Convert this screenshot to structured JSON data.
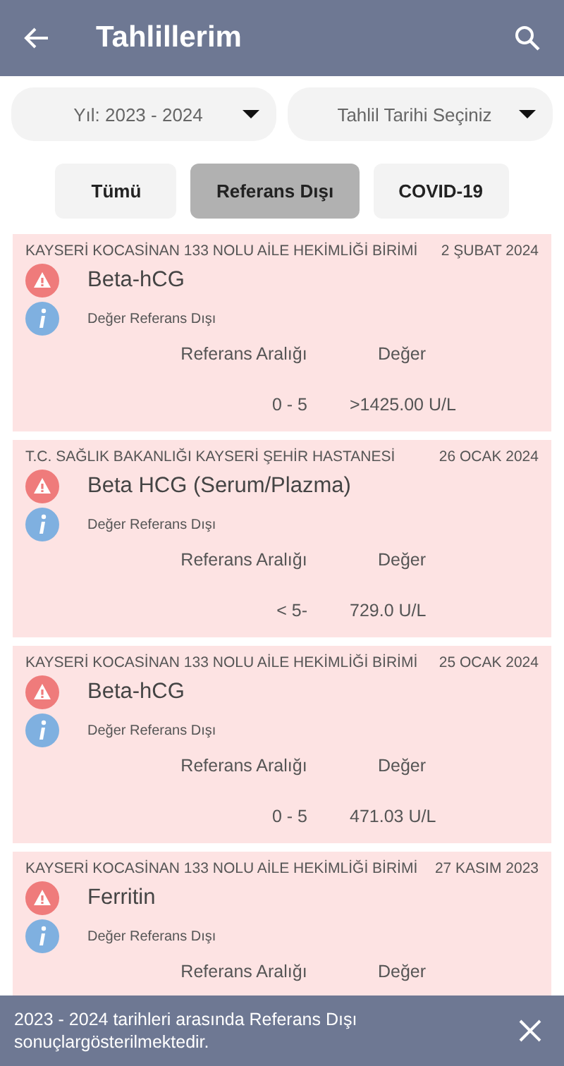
{
  "app_bar": {
    "title": "Tahlillerim"
  },
  "filters": [
    {
      "label": "Yıl: 2023 - 2024"
    },
    {
      "label": "Tahlil Tarihi Seçiniz"
    }
  ],
  "tabs": [
    {
      "label": "Tümü",
      "selected": false
    },
    {
      "label": "Referans Dışı",
      "selected": true
    },
    {
      "label": "COVID-19",
      "selected": false
    }
  ],
  "results": [
    {
      "institution": "KAYSERİ KOCASİNAN 133 NOLU AİLE HEKİMLİĞİ BİRİMİ",
      "date": "2 ŞUBAT 2024",
      "test": "Beta-hCG",
      "status": "Değer Referans Dışı",
      "range_label": "Referans Aralığı",
      "value_label": "Değer",
      "range": "0 - 5",
      "value": ">1425.00 U/L"
    },
    {
      "institution": "T.C. SAĞLIK BAKANLIĞI KAYSERİ ŞEHİR HASTANESİ",
      "date": "26 OCAK 2024",
      "test": "Beta HCG (Serum/Plazma)",
      "status": "Değer Referans Dışı",
      "range_label": "Referans Aralığı",
      "value_label": "Değer",
      "range": "< 5-",
      "value": "729.0 U/L"
    },
    {
      "institution": "KAYSERİ KOCASİNAN 133 NOLU AİLE HEKİMLİĞİ BİRİMİ",
      "date": "25 OCAK 2024",
      "test": "Beta-hCG",
      "status": "Değer Referans Dışı",
      "range_label": "Referans Aralığı",
      "value_label": "Değer",
      "range": "0 - 5",
      "value": "471.03 U/L"
    },
    {
      "institution": "KAYSERİ KOCASİNAN 133 NOLU AİLE HEKİMLİĞİ BİRİMİ",
      "date": "27 KASIM 2023",
      "test": "Ferritin",
      "status": "Değer Referans Dışı",
      "range_label": "Referans Aralığı",
      "value_label": "Değer"
    }
  ],
  "snackbar": {
    "message": "2023 - 2024 tarihleri arasında Referans Dışı sonuçlargösterilmektedir."
  }
}
